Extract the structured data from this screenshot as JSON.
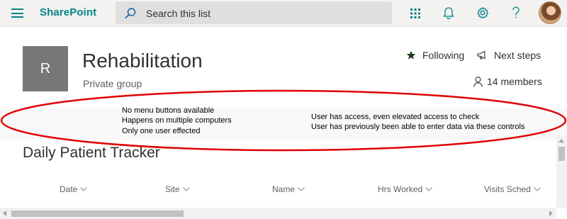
{
  "suite": {
    "brand": "SharePoint",
    "search_placeholder": "Search this list"
  },
  "group": {
    "logo_letter": "R",
    "title": "Rehabilitation",
    "subtitle": "Private group",
    "following_label": "Following",
    "next_steps_label": "Next steps",
    "members_label": "14 members"
  },
  "annotations": {
    "left": [
      "No menu buttons available",
      "Happens on multiple computers",
      "Only one user effected"
    ],
    "right": [
      "User has access, even elevated access to check",
      "User has previously been able to enter data via these controls"
    ]
  },
  "list": {
    "title": "Daily Patient Tracker",
    "columns": [
      "Date",
      "Site",
      "Name",
      "Hrs Worked",
      "Visits Sched"
    ]
  },
  "colors": {
    "brand": "#038387",
    "annotation_ellipse": "#e00000",
    "following_star": "#1f3d1f"
  },
  "icons": [
    "hamburger-menu-icon",
    "search-icon",
    "app-launcher-icon",
    "bell-icon",
    "gear-icon",
    "help-icon",
    "star-icon",
    "megaphone-icon",
    "person-icon",
    "chevron-down-icon"
  ]
}
